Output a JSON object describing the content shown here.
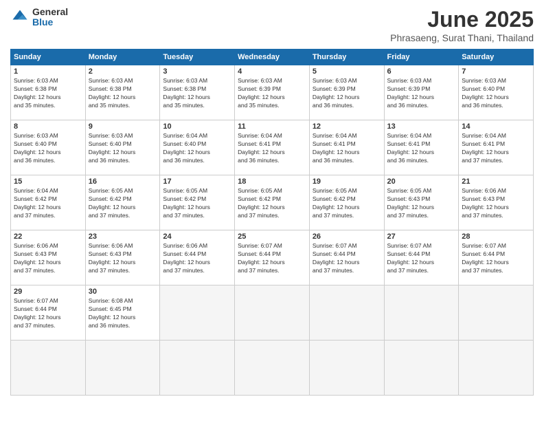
{
  "logo": {
    "general": "General",
    "blue": "Blue"
  },
  "title": "June 2025",
  "subtitle": "Phrasaeng, Surat Thani, Thailand",
  "headers": [
    "Sunday",
    "Monday",
    "Tuesday",
    "Wednesday",
    "Thursday",
    "Friday",
    "Saturday"
  ],
  "days": [
    {
      "num": "",
      "info": ""
    },
    {
      "num": "",
      "info": ""
    },
    {
      "num": "",
      "info": ""
    },
    {
      "num": "",
      "info": ""
    },
    {
      "num": "",
      "info": ""
    },
    {
      "num": "",
      "info": ""
    },
    {
      "num": "",
      "info": ""
    },
    {
      "num": "1",
      "info": "Sunrise: 6:03 AM\nSunset: 6:38 PM\nDaylight: 12 hours\nand 35 minutes."
    },
    {
      "num": "2",
      "info": "Sunrise: 6:03 AM\nSunset: 6:38 PM\nDaylight: 12 hours\nand 35 minutes."
    },
    {
      "num": "3",
      "info": "Sunrise: 6:03 AM\nSunset: 6:38 PM\nDaylight: 12 hours\nand 35 minutes."
    },
    {
      "num": "4",
      "info": "Sunrise: 6:03 AM\nSunset: 6:39 PM\nDaylight: 12 hours\nand 35 minutes."
    },
    {
      "num": "5",
      "info": "Sunrise: 6:03 AM\nSunset: 6:39 PM\nDaylight: 12 hours\nand 36 minutes."
    },
    {
      "num": "6",
      "info": "Sunrise: 6:03 AM\nSunset: 6:39 PM\nDaylight: 12 hours\nand 36 minutes."
    },
    {
      "num": "7",
      "info": "Sunrise: 6:03 AM\nSunset: 6:40 PM\nDaylight: 12 hours\nand 36 minutes."
    },
    {
      "num": "8",
      "info": "Sunrise: 6:03 AM\nSunset: 6:40 PM\nDaylight: 12 hours\nand 36 minutes."
    },
    {
      "num": "9",
      "info": "Sunrise: 6:03 AM\nSunset: 6:40 PM\nDaylight: 12 hours\nand 36 minutes."
    },
    {
      "num": "10",
      "info": "Sunrise: 6:04 AM\nSunset: 6:40 PM\nDaylight: 12 hours\nand 36 minutes."
    },
    {
      "num": "11",
      "info": "Sunrise: 6:04 AM\nSunset: 6:41 PM\nDaylight: 12 hours\nand 36 minutes."
    },
    {
      "num": "12",
      "info": "Sunrise: 6:04 AM\nSunset: 6:41 PM\nDaylight: 12 hours\nand 36 minutes."
    },
    {
      "num": "13",
      "info": "Sunrise: 6:04 AM\nSunset: 6:41 PM\nDaylight: 12 hours\nand 36 minutes."
    },
    {
      "num": "14",
      "info": "Sunrise: 6:04 AM\nSunset: 6:41 PM\nDaylight: 12 hours\nand 37 minutes."
    },
    {
      "num": "15",
      "info": "Sunrise: 6:04 AM\nSunset: 6:42 PM\nDaylight: 12 hours\nand 37 minutes."
    },
    {
      "num": "16",
      "info": "Sunrise: 6:05 AM\nSunset: 6:42 PM\nDaylight: 12 hours\nand 37 minutes."
    },
    {
      "num": "17",
      "info": "Sunrise: 6:05 AM\nSunset: 6:42 PM\nDaylight: 12 hours\nand 37 minutes."
    },
    {
      "num": "18",
      "info": "Sunrise: 6:05 AM\nSunset: 6:42 PM\nDaylight: 12 hours\nand 37 minutes."
    },
    {
      "num": "19",
      "info": "Sunrise: 6:05 AM\nSunset: 6:42 PM\nDaylight: 12 hours\nand 37 minutes."
    },
    {
      "num": "20",
      "info": "Sunrise: 6:05 AM\nSunset: 6:43 PM\nDaylight: 12 hours\nand 37 minutes."
    },
    {
      "num": "21",
      "info": "Sunrise: 6:06 AM\nSunset: 6:43 PM\nDaylight: 12 hours\nand 37 minutes."
    },
    {
      "num": "22",
      "info": "Sunrise: 6:06 AM\nSunset: 6:43 PM\nDaylight: 12 hours\nand 37 minutes."
    },
    {
      "num": "23",
      "info": "Sunrise: 6:06 AM\nSunset: 6:43 PM\nDaylight: 12 hours\nand 37 minutes."
    },
    {
      "num": "24",
      "info": "Sunrise: 6:06 AM\nSunset: 6:44 PM\nDaylight: 12 hours\nand 37 minutes."
    },
    {
      "num": "25",
      "info": "Sunrise: 6:07 AM\nSunset: 6:44 PM\nDaylight: 12 hours\nand 37 minutes."
    },
    {
      "num": "26",
      "info": "Sunrise: 6:07 AM\nSunset: 6:44 PM\nDaylight: 12 hours\nand 37 minutes."
    },
    {
      "num": "27",
      "info": "Sunrise: 6:07 AM\nSunset: 6:44 PM\nDaylight: 12 hours\nand 37 minutes."
    },
    {
      "num": "28",
      "info": "Sunrise: 6:07 AM\nSunset: 6:44 PM\nDaylight: 12 hours\nand 37 minutes."
    },
    {
      "num": "29",
      "info": "Sunrise: 6:07 AM\nSunset: 6:44 PM\nDaylight: 12 hours\nand 37 minutes."
    },
    {
      "num": "30",
      "info": "Sunrise: 6:08 AM\nSunset: 6:45 PM\nDaylight: 12 hours\nand 36 minutes."
    },
    {
      "num": "",
      "info": ""
    },
    {
      "num": "",
      "info": ""
    },
    {
      "num": "",
      "info": ""
    },
    {
      "num": "",
      "info": ""
    },
    {
      "num": "",
      "info": ""
    }
  ]
}
